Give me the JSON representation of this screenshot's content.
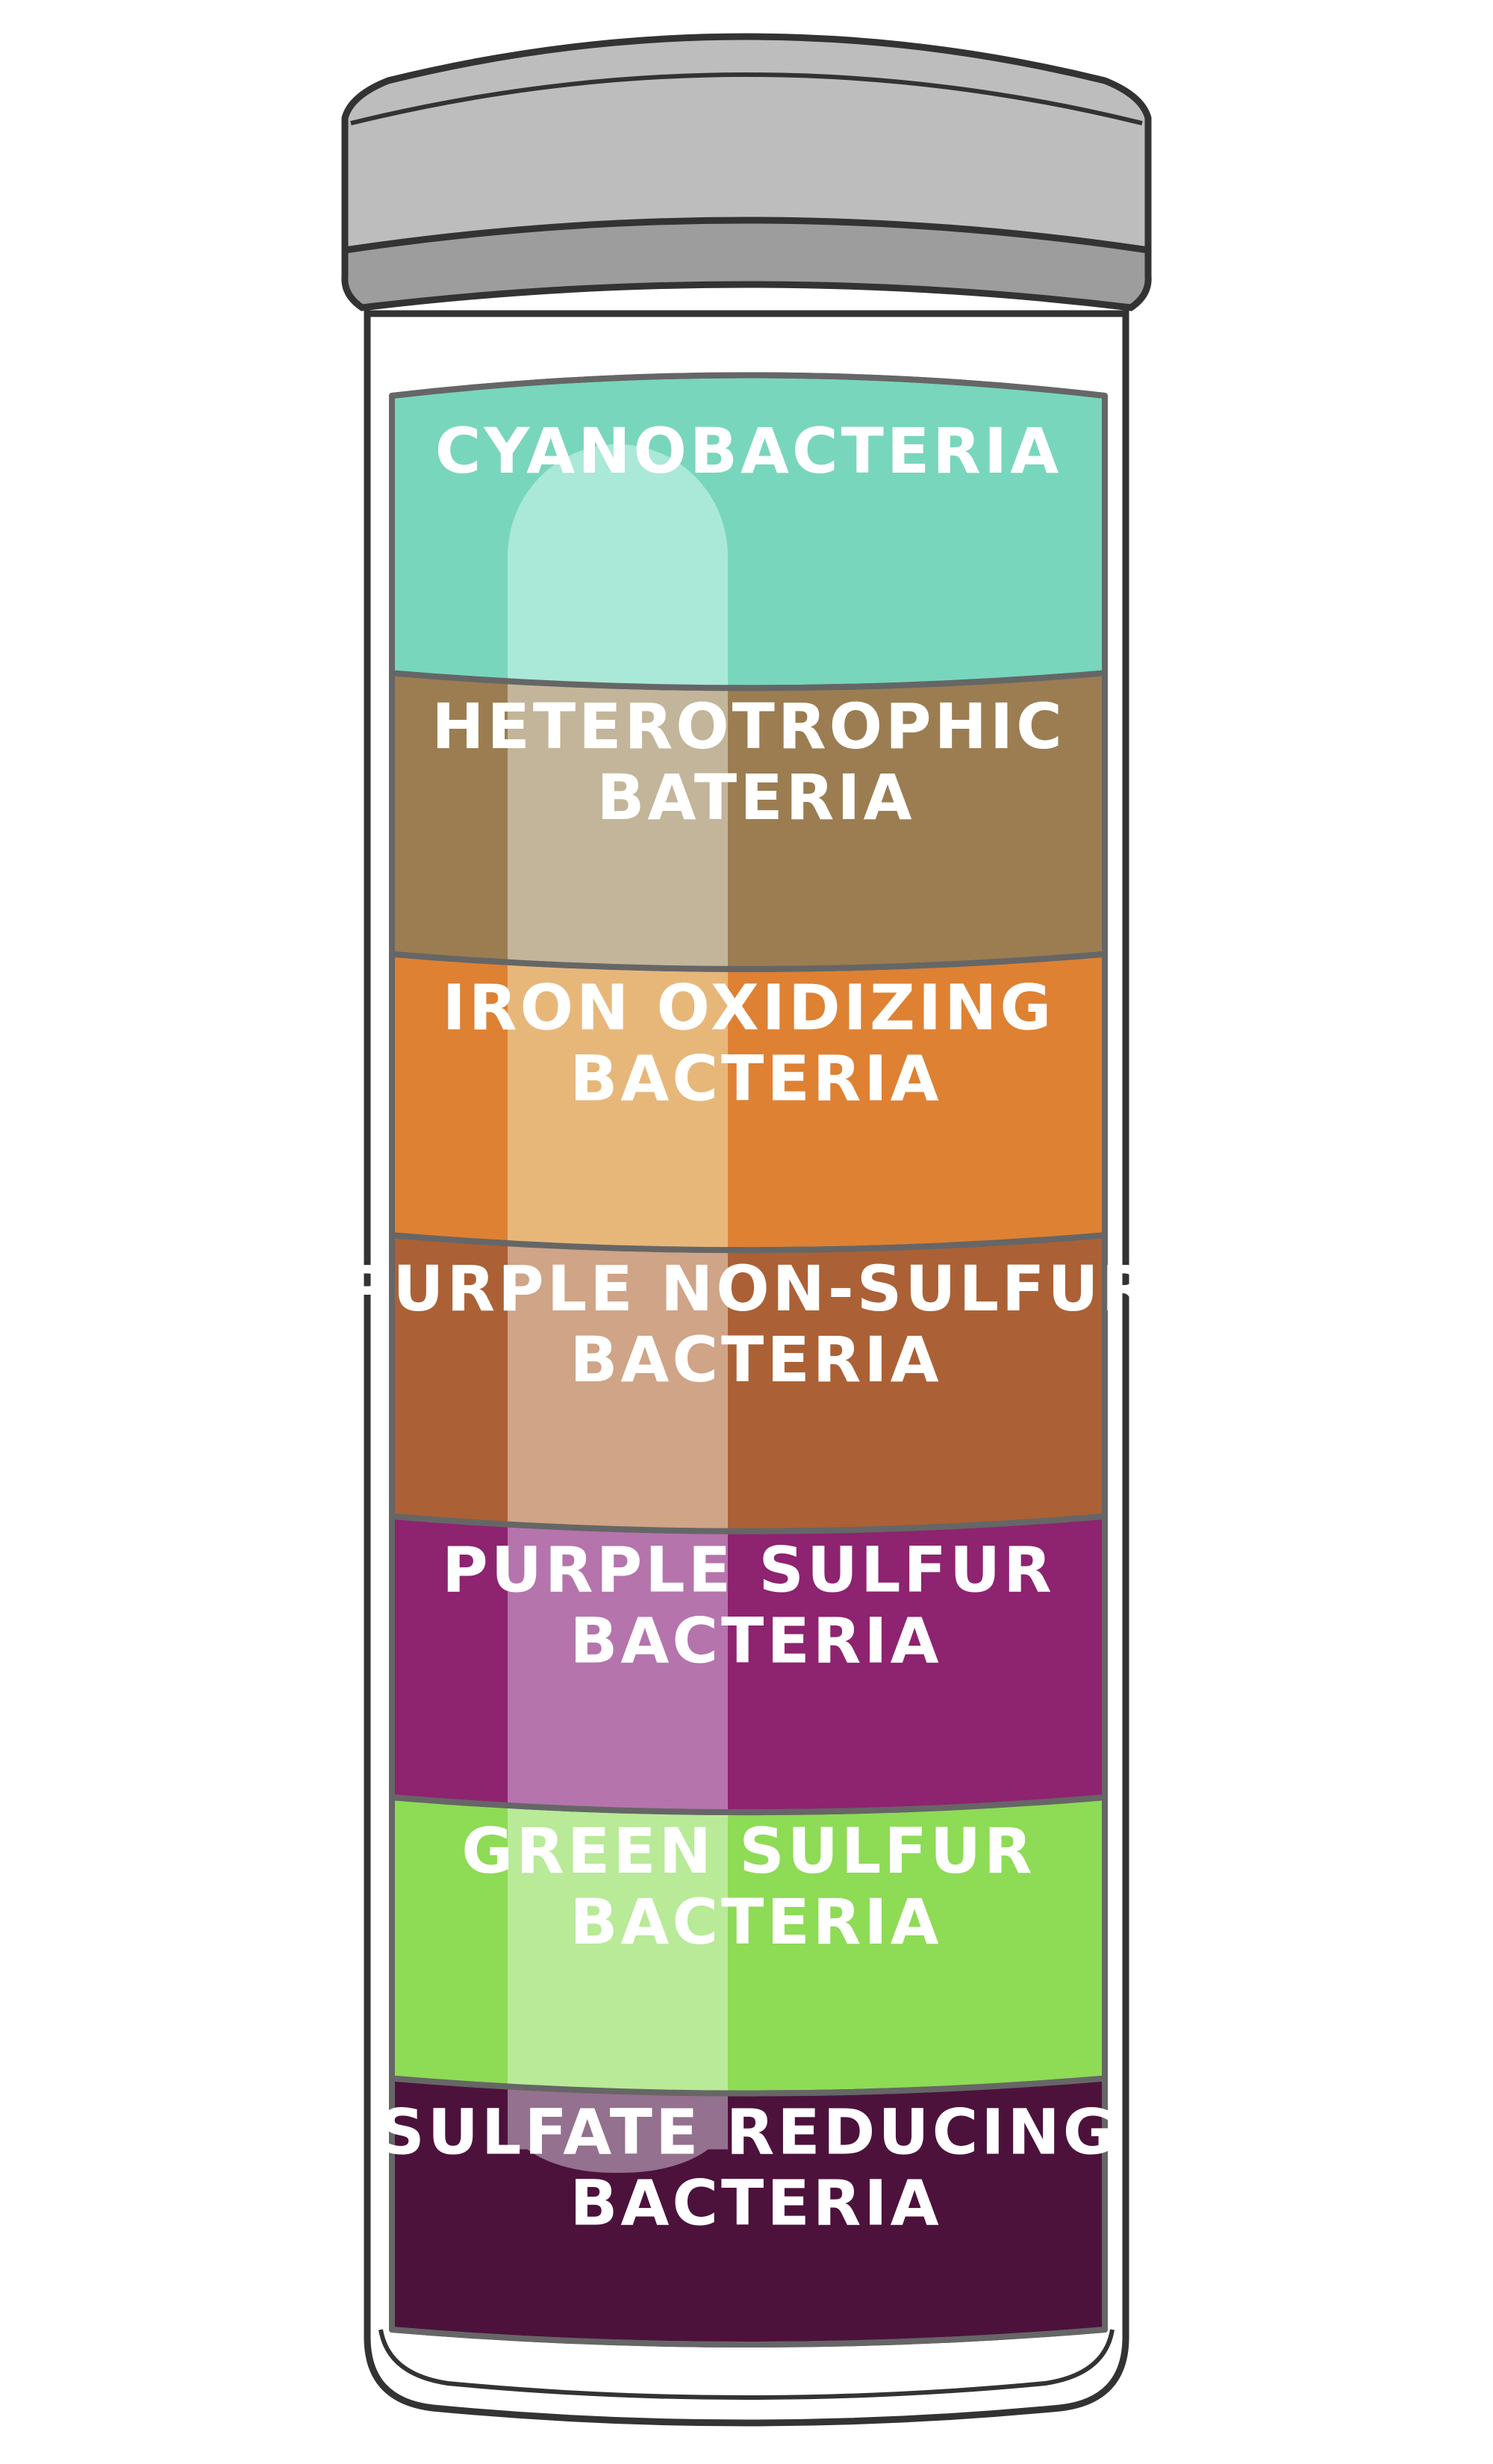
{
  "jar": {
    "lid_color": "#bdbdbd",
    "lid_band_color": "#9d9d9d",
    "outline_color": "#333333",
    "glass_color": "#ffffff"
  },
  "layers": [
    {
      "name": "cyanobacteria",
      "lines": [
        "CYANOBACTERIA"
      ],
      "color": "#78d6bc",
      "highlight": "#aae8d8"
    },
    {
      "name": "heterotrophic-bacteria",
      "lines": [
        "HETEROTROPHIC",
        "BATERIA"
      ],
      "color": "#9b7d51",
      "highlight": "#c3b59a"
    },
    {
      "name": "iron-oxidizing-bacteria",
      "lines": [
        "IRON OXIDIZING",
        "BACTERIA"
      ],
      "color": "#de8133",
      "highlight": "#e7b77a"
    },
    {
      "name": "purple-non-sulfur-bacteria",
      "lines": [
        "PURPLE NON-SULFUR",
        "BACTERIA"
      ],
      "color": "#ab6135",
      "highlight": "#cfa487"
    },
    {
      "name": "purple-sulfur-bacteria",
      "lines": [
        "PURPLE SULFUR",
        "BACTERIA"
      ],
      "color": "#8e2370",
      "highlight": "#b574ac"
    },
    {
      "name": "green-sulfur-bacteria",
      "lines": [
        "GREEN SULFUR",
        "BACTERIA"
      ],
      "color": "#8edb56",
      "highlight": "#b8ea98"
    },
    {
      "name": "sulfate-reducing-bacteria",
      "lines": [
        "SULFATE REDUCING",
        "BACTERIA"
      ],
      "color": "#4c123c",
      "highlight": "#94718e"
    }
  ]
}
